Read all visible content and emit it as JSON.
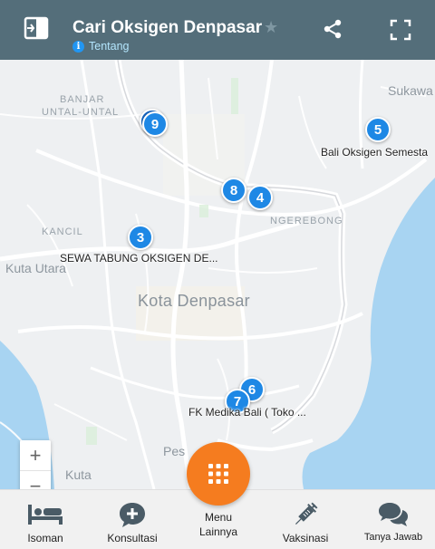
{
  "header": {
    "title": "Cari Oksigen Denpasar",
    "subtitle": "Tentang"
  },
  "map": {
    "labels": {
      "banjar": "BANJAR",
      "untal": "UNTAL-UNTAL",
      "sukawati": "Sukawa",
      "ngerebong": "NGEREBONG",
      "kancil": "KANCIL",
      "kuta_utara": "Kuta Utara",
      "city": "Kota Denpasar",
      "pesanggaran": "Pes",
      "kuta": "Kuta"
    },
    "markers": [
      {
        "number": "9"
      },
      {
        "number": "5",
        "label": "Bali Oksigen Semesta"
      },
      {
        "number": "8"
      },
      {
        "number": "4"
      },
      {
        "number": "3",
        "label": "SEWA TABUNG OKSIGEN DE..."
      },
      {
        "number": "6"
      },
      {
        "number": "7",
        "label": "FK Medika Bali ( Toko ..."
      }
    ],
    "zoom_in": "+",
    "zoom_out": "−"
  },
  "bottom_nav": {
    "isoman": "Isoman",
    "konsultasi": "Konsultasi",
    "menu_line1": "Menu",
    "menu_line2": "Lainnya",
    "vaksinasi": "Vaksinasi",
    "tanya_jawab": "Tanya Jawab"
  },
  "colors": {
    "header": "#546e7a",
    "marker": "#1e88e5",
    "fab": "#f57c1f",
    "water": "#a8d4f2"
  }
}
